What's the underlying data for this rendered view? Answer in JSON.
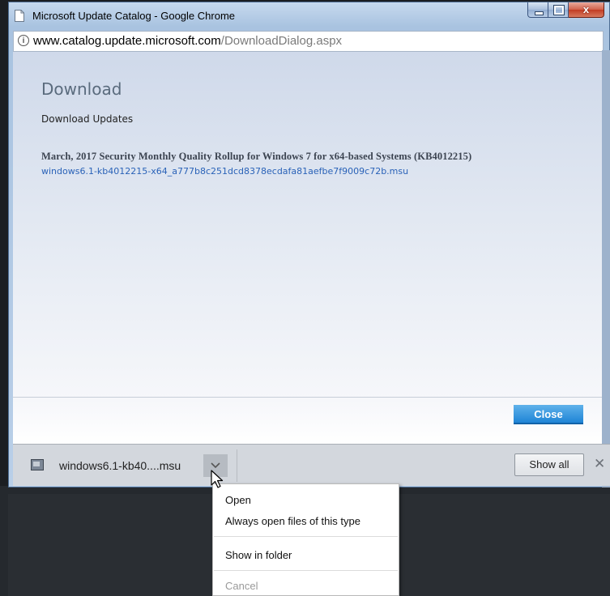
{
  "window": {
    "title": "Microsoft Update Catalog - Google Chrome"
  },
  "address": {
    "domain": "www.catalog.update.microsoft.com",
    "path": "/DownloadDialog.aspx"
  },
  "dialog": {
    "heading": "Download",
    "subheading": "Download Updates",
    "update_title": "March, 2017 Security Monthly Quality Rollup for Windows 7 for x64-based Systems (KB4012215)",
    "update_link": "windows6.1-kb4012215-x64_a777b8c251dcd8378ecdafa81aefbe7f9009c72b.msu",
    "close_label": "Close"
  },
  "download_bar": {
    "filename": "windows6.1-kb40....msu",
    "show_all_label": "Show all",
    "close_glyph": "✕"
  },
  "context_menu": {
    "items": [
      {
        "label": "Open",
        "enabled": true
      },
      {
        "label": "Always open files of this type",
        "enabled": true
      },
      {
        "label": "Show in folder",
        "enabled": true
      },
      {
        "label": "Cancel",
        "enabled": false
      }
    ]
  },
  "icons": {
    "page": "page-icon",
    "info": "info-icon",
    "file": "msu-file-icon",
    "chevron": "chevron-down-icon",
    "cursor": "mouse-cursor-icon"
  }
}
